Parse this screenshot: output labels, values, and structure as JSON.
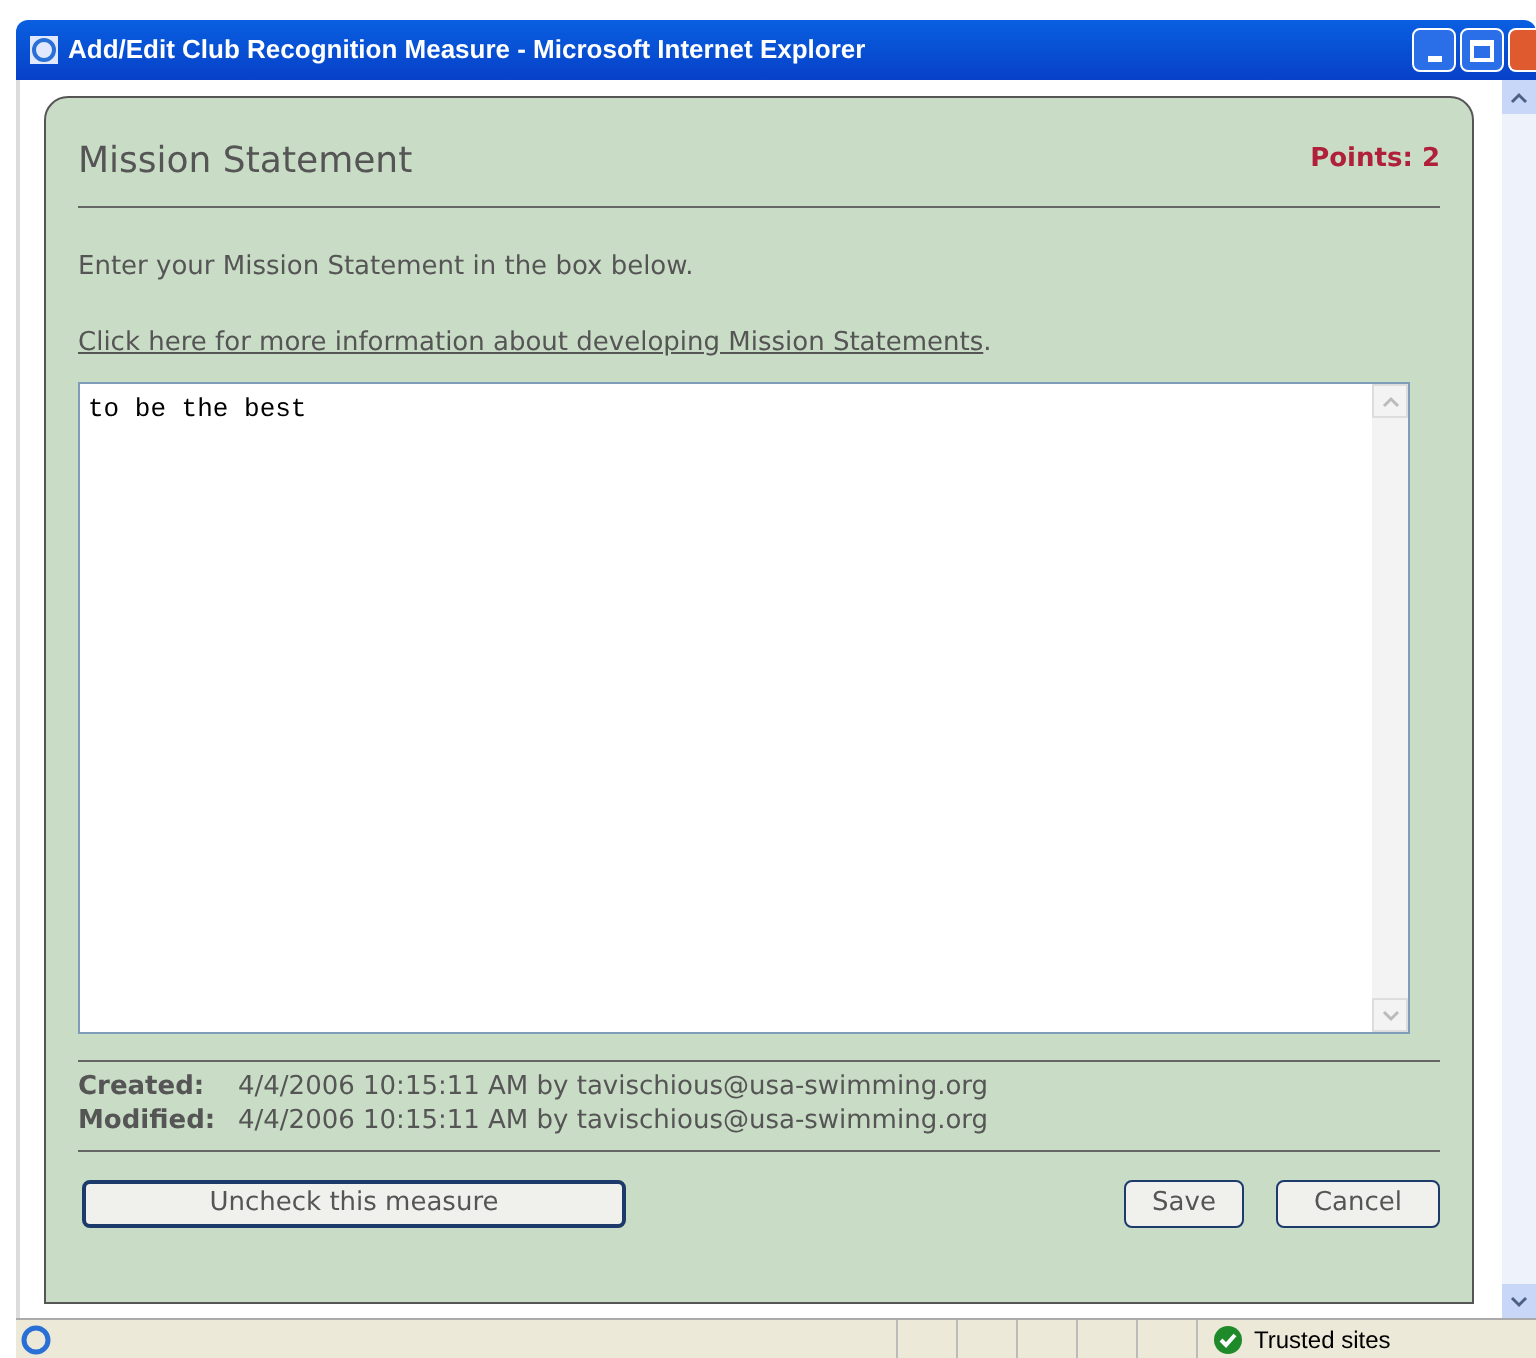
{
  "window": {
    "title": "Add/Edit Club Recognition Measure - Microsoft Internet Explorer"
  },
  "panel": {
    "heading": "Mission Statement",
    "points": "Points: 2",
    "instruction": "Enter your Mission Statement in the box below.",
    "link": "Click here for more information about developing Mission Statements",
    "link_suffix": ".",
    "value": "to be the best"
  },
  "meta": [
    {
      "label": "Created:",
      "value": "4/4/2006 10:15:11 AM by tavischious@usa-swimming.org"
    },
    {
      "label": "Modified:",
      "value": "4/4/2006 10:15:11 AM by tavischious@usa-swimming.org"
    }
  ],
  "buttons": {
    "uncheck": "Uncheck this measure",
    "save": "Save",
    "cancel": "Cancel"
  },
  "status_bar": {
    "zone": "Trusted sites"
  }
}
